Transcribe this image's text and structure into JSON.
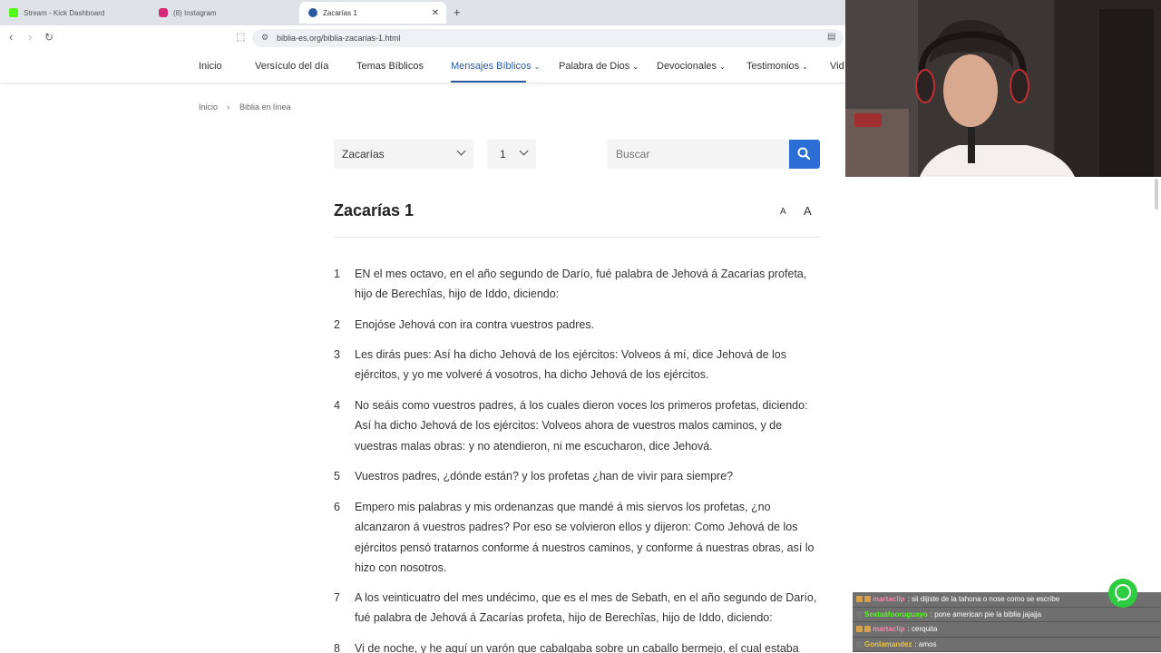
{
  "browser": {
    "tabs": [
      {
        "label": "Stream - Kick Dashboard",
        "icon": "kick-logo-icon",
        "color": "#53fc18"
      },
      {
        "label": "(8) Instagram",
        "icon": "instagram-logo-icon",
        "color": "#d62976"
      },
      {
        "label": "Zacarías 1",
        "icon": "site-favicon-icon",
        "color": "#2c5aa0",
        "active": true
      }
    ],
    "url": "biblia-es.org/biblia-zacarias-1.html"
  },
  "site": {
    "nav": [
      {
        "label": "Inicio"
      },
      {
        "label": "Versículo del día"
      },
      {
        "label": "Temas Bíblicos"
      },
      {
        "label": "Mensajes Bíblicos",
        "dropdown": true,
        "active": true
      },
      {
        "label": "Palabra de Dios",
        "dropdown": true
      },
      {
        "label": "Devocionales",
        "dropdown": true
      },
      {
        "label": "Testimonios",
        "dropdown": true
      },
      {
        "label": "Vid"
      }
    ],
    "breadcrumb": [
      "Inicio",
      "Biblia en línea"
    ],
    "book_select": "Zacarías",
    "chapter_select": "1",
    "search_placeholder": "Buscar",
    "title": "Zacarías 1",
    "font_small": "A",
    "font_large": "A",
    "accent": "#2c5aa0",
    "search_button_color": "#2b6fd6"
  },
  "verses": [
    {
      "n": "1",
      "text": "EN el mes octavo, en el año segundo de Darío, fué palabra de Jehová á Zacarías profeta, hijo de Berechîas, hijo de Iddo, diciendo:"
    },
    {
      "n": "2",
      "text": "Enojóse Jehová con ira contra vuestros padres."
    },
    {
      "n": "3",
      "text": "Les dirás pues: Así ha dicho Jehová de los ejércitos: Volveos á mí, dice Jehová de los ejércitos, y yo me volveré á vosotros, ha dicho Jehová de los ejércitos."
    },
    {
      "n": "4",
      "text": "No seáis como vuestros padres, á los cuales dieron voces los primeros profetas, diciendo: Así ha dicho Jehová de los ejércitos: Volveos ahora de vuestros malos caminos, y de vuestras malas obras: y no atendieron, ni me escucharon, dice Jehová."
    },
    {
      "n": "5",
      "text": "Vuestros padres, ¿dónde están? y los profetas ¿han de vivir para siempre?"
    },
    {
      "n": "6",
      "text": "Empero mis palabras y mis ordenanzas que mandé á mis siervos los profetas, ¿no alcanzaron á vuestros padres? Por eso se volvieron ellos y dijeron: Como Jehová de los ejércitos pensó tratarnos conforme á nuestros caminos, y conforme á nuestras obras, así lo hizo con nosotros."
    },
    {
      "n": "7",
      "text": "A los veinticuatro del mes undécimo, que es el mes de Sebath, en el año segundo de Darío, fué palabra de Jehová á Zacarías profeta, hijo de Berechîas, hijo de Iddo, diciendo:"
    },
    {
      "n": "8",
      "text": "Vi de noche, y he aquí un varón que cabalgaba sobre un caballo bermejo, el cual estaba"
    }
  ],
  "chat": [
    {
      "user": "martaclip",
      "message": ": sii dijiste de la tahona o nose como se escribe",
      "color": "#f28bb0"
    },
    {
      "user": "Sextaáfooruguayo",
      "message": ": pone american pie la biblia jajajja",
      "color": "#53fc18"
    },
    {
      "user": "martaclip",
      "message": ": cerquita",
      "color": "#f28bb0"
    },
    {
      "user": "Gonlamandez",
      "message": ": amos",
      "color": "#e8c34a"
    }
  ]
}
